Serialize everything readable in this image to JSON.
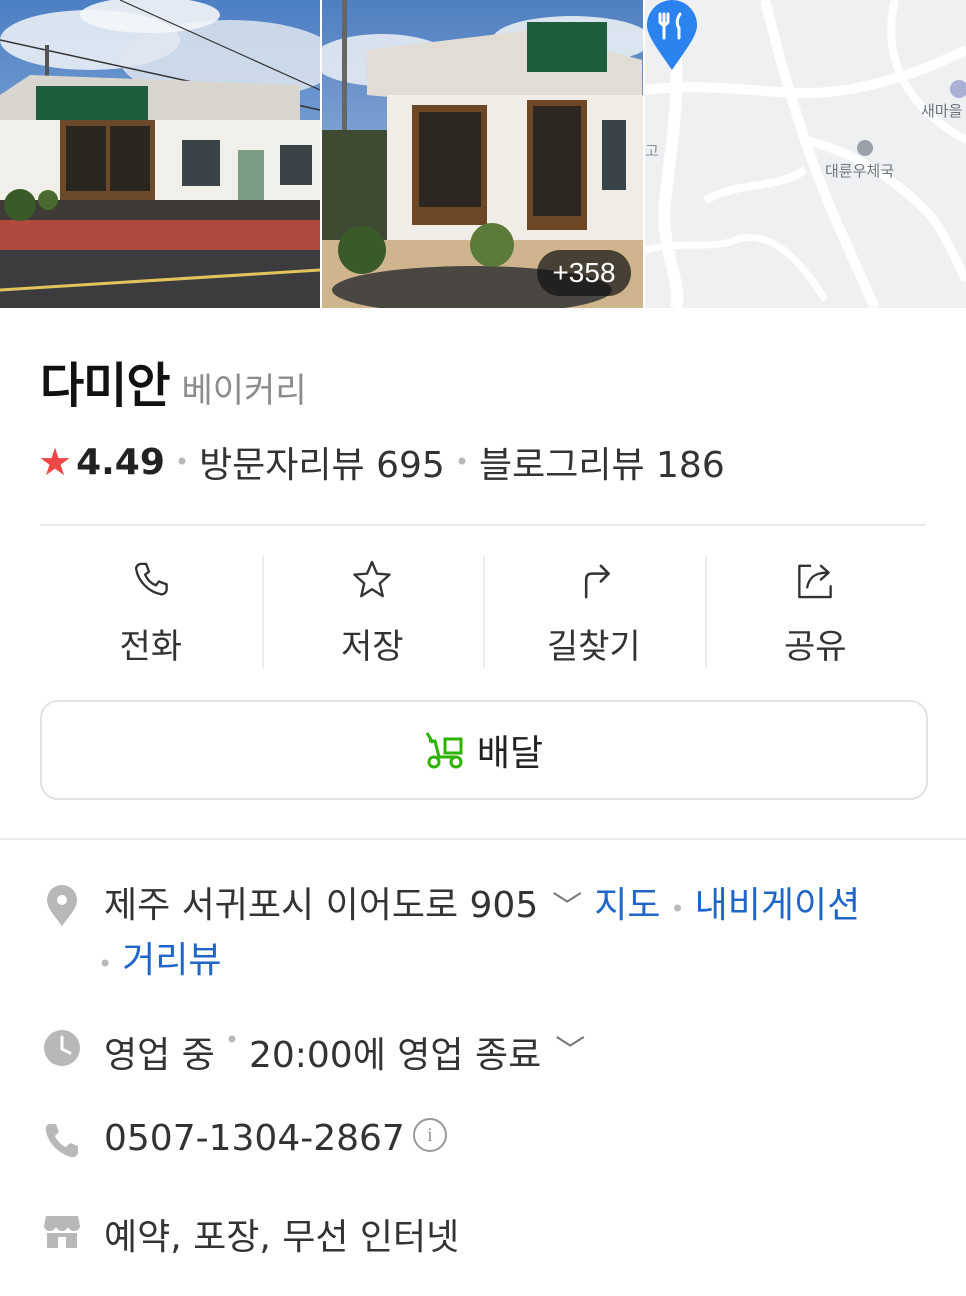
{
  "gallery": {
    "more_photos": "+358",
    "map_labels": {
      "post_office": "대륜우체국",
      "village": "새마을",
      "edge": "고"
    }
  },
  "place": {
    "name": "다미안",
    "category": "베이커리",
    "rating": "4.49",
    "visitor_reviews": "방문자리뷰 695",
    "blog_reviews": "블로그리뷰 186"
  },
  "actions": [
    {
      "label": "전화",
      "icon": "phone-icon"
    },
    {
      "label": "저장",
      "icon": "star-icon"
    },
    {
      "label": "길찾기",
      "icon": "directions-icon"
    },
    {
      "label": "공유",
      "icon": "share-icon"
    }
  ],
  "delivery": {
    "label": "배달",
    "icon": "delivery-scooter-icon",
    "icon_color": "#2db400"
  },
  "info": {
    "address": "제주 서귀포시 이어도로 905",
    "map_link": "지도",
    "navigation_link": "내비게이션",
    "streetview_link": "거리뷰",
    "status": "영업 중",
    "hours": "20:00에 영업 종료",
    "phone": "0507-1304-2867",
    "amenities": "예약, 포장, 무선 인터넷"
  },
  "colors": {
    "accent_link": "#1f66c7",
    "star": "#ef4646",
    "pin": "#2b83f0"
  }
}
